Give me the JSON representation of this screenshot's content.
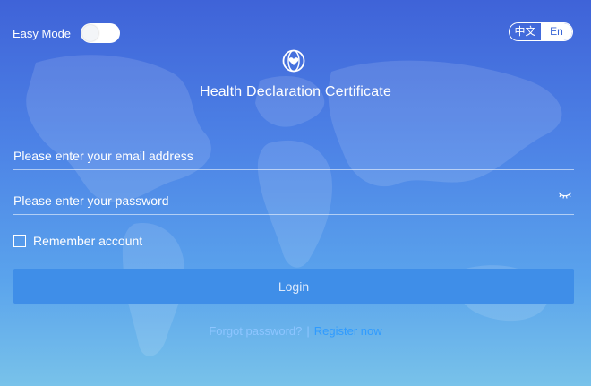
{
  "header": {
    "easy_mode_label": "Easy Mode",
    "easy_mode_on": false,
    "lang_options": [
      "中文",
      "En"
    ],
    "lang_selected": "En"
  },
  "title": "Health Declaration Certificate",
  "form": {
    "email_placeholder": "Please enter your email address",
    "email_value": "",
    "password_placeholder": "Please enter your password",
    "password_value": "",
    "remember_label": "Remember account",
    "remember_checked": false,
    "login_label": "Login"
  },
  "footer": {
    "forgot_label": "Forgot password?",
    "separator": "|",
    "register_label": "Register now"
  },
  "icons": {
    "logo": "heart-globe-icon",
    "password_toggle": "eye-closed-icon"
  },
  "colors": {
    "bg_top": "#3f63d8",
    "bg_bottom": "#78c2ea",
    "login_button": "#3f8ee8",
    "link": "#2f9bff"
  }
}
